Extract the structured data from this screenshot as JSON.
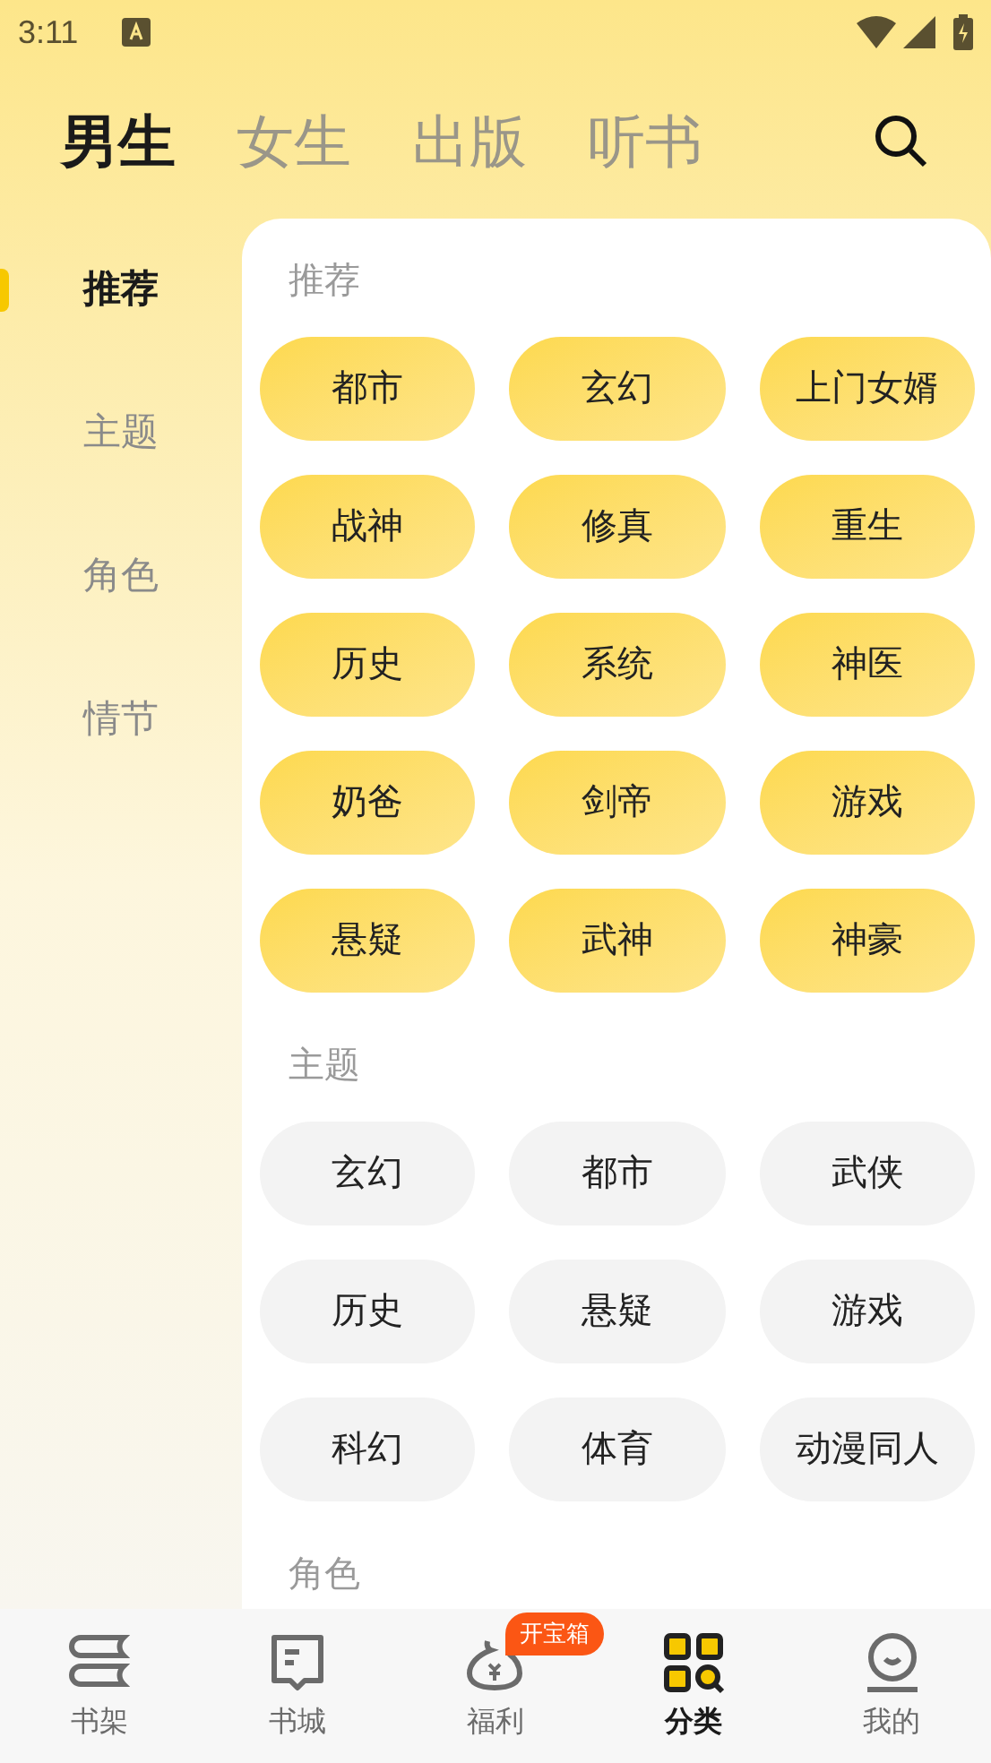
{
  "status_bar": {
    "time": "3:11"
  },
  "tabs": [
    {
      "label": "男生",
      "selected": true
    },
    {
      "label": "女生",
      "selected": false
    },
    {
      "label": "出版",
      "selected": false
    },
    {
      "label": "听书",
      "selected": false
    }
  ],
  "sidebar": {
    "items": [
      {
        "label": "推荐",
        "selected": true
      },
      {
        "label": "主题",
        "selected": false
      },
      {
        "label": "角色",
        "selected": false
      },
      {
        "label": "情节",
        "selected": false
      }
    ]
  },
  "sections": [
    {
      "title": "推荐",
      "kind": "featured",
      "tags": [
        "都市",
        "玄幻",
        "上门女婿",
        "战神",
        "修真",
        "重生",
        "历史",
        "系统",
        "神医",
        "奶爸",
        "剑帝",
        "游戏",
        "悬疑",
        "武神",
        "神豪"
      ]
    },
    {
      "title": "主题",
      "kind": "plain",
      "tags": [
        "玄幻",
        "都市",
        "武侠",
        "历史",
        "悬疑",
        "游戏",
        "科幻",
        "体育",
        "动漫同人"
      ]
    },
    {
      "title": "角色"
    }
  ],
  "bottom_nav": [
    {
      "label": "书架",
      "selected": false
    },
    {
      "label": "书城",
      "selected": false
    },
    {
      "label": "福利",
      "selected": false,
      "badge": "开宝箱"
    },
    {
      "label": "分类",
      "selected": true
    },
    {
      "label": "我的",
      "selected": false
    }
  ]
}
